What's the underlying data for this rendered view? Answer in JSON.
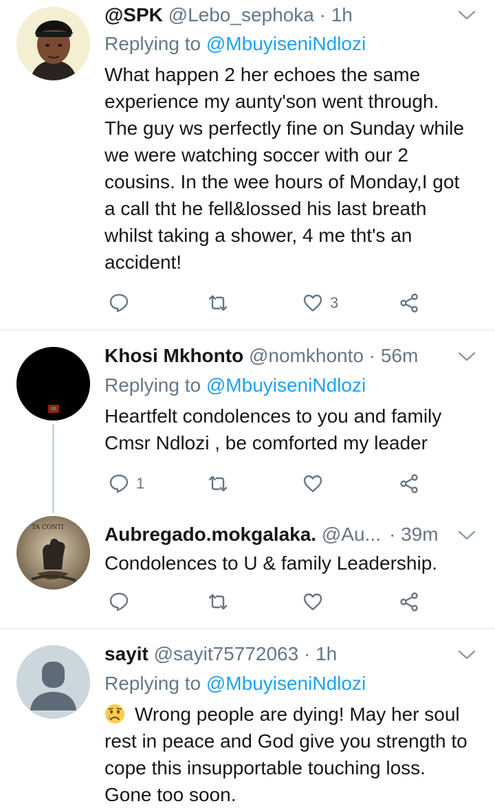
{
  "tweets": [
    {
      "name": "@SPK",
      "handle": "@Lebo_sephoka",
      "time": "1h",
      "replying_prefix": "Replying to",
      "replying_to": "@MbuyiseniNdlozi",
      "text": "What happen 2 her echoes the same experience my aunty'son went through. The guy ws perfectly fine on Sunday while we were watching soccer with our 2 cousins. In the wee hours of Monday,I got a call tht he fell&lossed his last breath whilst taking a shower, 4 me tht's an accident!",
      "reply_count": "",
      "retweet_count": "",
      "like_count": "3"
    },
    {
      "name": "Khosi Mkhonto",
      "handle": "@nomkhonto",
      "time": "56m",
      "replying_prefix": "Replying to",
      "replying_to": "@MbuyiseniNdlozi",
      "text": "Heartfelt condolences to you and family Cmsr Ndlozi , be comforted my leader",
      "reply_count": "1",
      "retweet_count": "",
      "like_count": ""
    },
    {
      "name": "Aubregado.mokgalaka.",
      "handle": "@Au...",
      "time": "39m",
      "text": "Condolences to U & family Leadership.",
      "avatar_text": "TA CONTI",
      "reply_count": "",
      "retweet_count": "",
      "like_count": ""
    },
    {
      "name": "sayit",
      "handle": "@sayit75772063",
      "time": "1h",
      "replying_prefix": "Replying to",
      "replying_to": "@MbuyiseniNdlozi",
      "text": "Wrong people are dying! May her soul rest in peace and God give you strength to cope this insupportable touching loss. Gone too soon.",
      "emoji": "crying-face-emoji"
    }
  ],
  "separator": "·",
  "colors": {
    "text": "#14171a",
    "secondary": "#657786",
    "link": "#1da1f2",
    "divider": "#e1e8ed",
    "thread_line": "#ccd6dd"
  }
}
